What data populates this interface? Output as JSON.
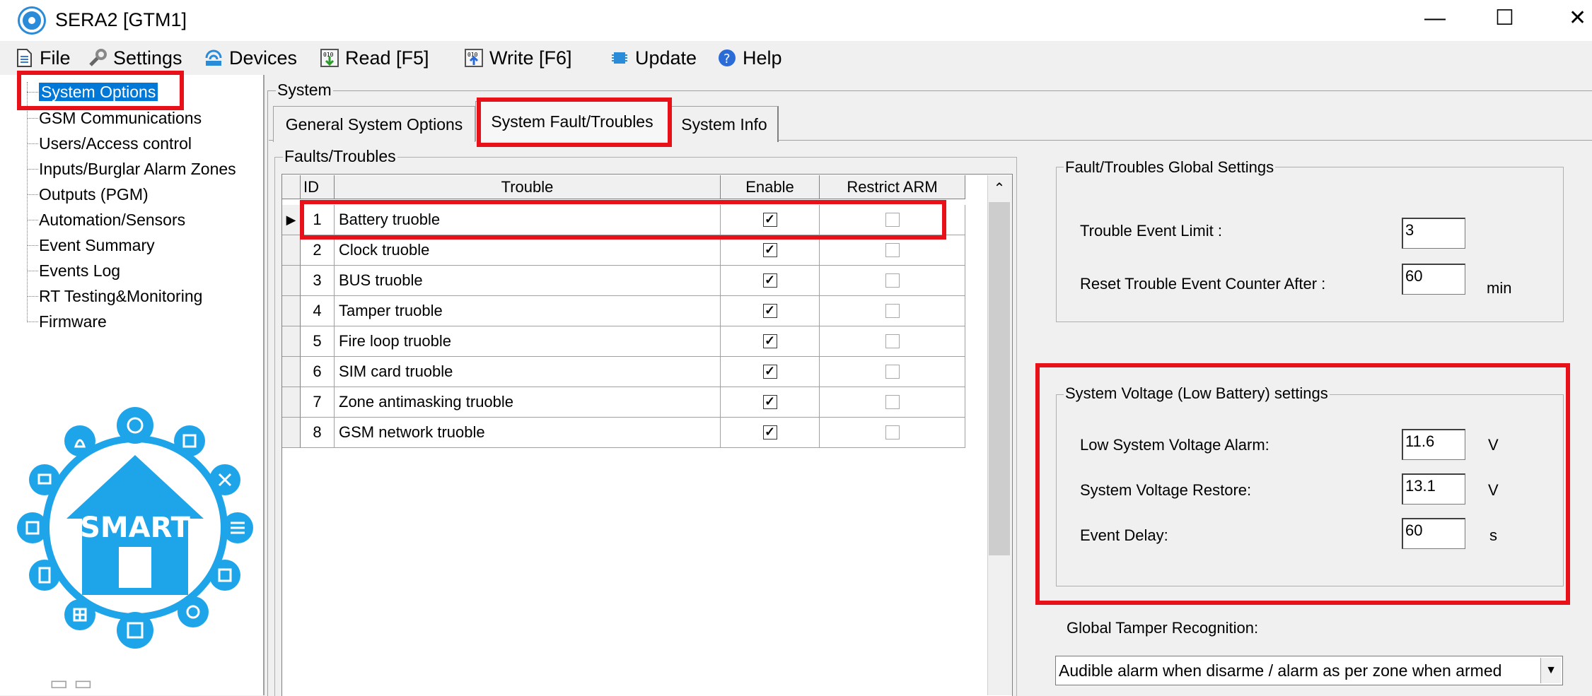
{
  "window": {
    "title": "SERA2 [GTM1]",
    "minimize_label": "—",
    "maximize_label": "☐",
    "close_label": "✕"
  },
  "menubar": {
    "file": "File",
    "settings": "Settings",
    "devices": "Devices",
    "read": "Read [F5]",
    "write": "Write [F6]",
    "update": "Update",
    "help": "Help"
  },
  "tree": {
    "items": [
      "System Options",
      "GSM Communications",
      "Users/Access control",
      "Inputs/Burglar Alarm Zones",
      "Outputs (PGM)",
      "Automation/Sensors",
      "Event Summary",
      "Events Log",
      "RT Testing&Monitoring",
      "Firmware"
    ]
  },
  "system": {
    "group_title": "System",
    "tabs": [
      "General System Options",
      "System Fault/Troubles",
      "System Info"
    ]
  },
  "faults": {
    "group_title": "Faults/Troubles",
    "columns": [
      "ID",
      "Trouble",
      "Enable",
      "Restrict ARM"
    ],
    "rows": [
      {
        "id": "1",
        "trouble": "Battery truoble",
        "enable": true,
        "restrict": false
      },
      {
        "id": "2",
        "trouble": "Clock truoble",
        "enable": true,
        "restrict": false
      },
      {
        "id": "3",
        "trouble": "BUS truoble",
        "enable": true,
        "restrict": false
      },
      {
        "id": "4",
        "trouble": "Tamper truoble",
        "enable": true,
        "restrict": false
      },
      {
        "id": "5",
        "trouble": "Fire loop truoble",
        "enable": true,
        "restrict": false
      },
      {
        "id": "6",
        "trouble": "SIM card truoble",
        "enable": true,
        "restrict": false
      },
      {
        "id": "7",
        "trouble": "Zone antimasking truoble",
        "enable": true,
        "restrict": false
      },
      {
        "id": "8",
        "trouble": "GSM network truoble",
        "enable": true,
        "restrict": false
      }
    ]
  },
  "global_settings": {
    "group_title": "Fault/Troubles Global Settings",
    "event_limit_label": "Trouble Event Limit :",
    "event_limit_value": "3",
    "reset_counter_label": "Reset Trouble Event Counter After :",
    "reset_counter_value": "60",
    "reset_counter_unit": "min"
  },
  "voltage": {
    "group_title": "System Voltage (Low Battery) settings",
    "low_alarm_label": "Low System Voltage Alarm:",
    "low_alarm_value": "11.6",
    "low_alarm_unit": "V",
    "restore_label": "System Voltage Restore:",
    "restore_value": "13.1",
    "restore_unit": "V",
    "delay_label": "Event Delay:",
    "delay_value": "60",
    "delay_unit": "s"
  },
  "tamper": {
    "label": "Global Tamper Recognition:",
    "selected": "Audible alarm when disarme / alarm as per zone when armed"
  },
  "logo": {
    "text": "SMART"
  },
  "colors": {
    "selection": "#0078d7",
    "highlight": "#e8111a",
    "logo_blue": "#1ea4e9"
  }
}
